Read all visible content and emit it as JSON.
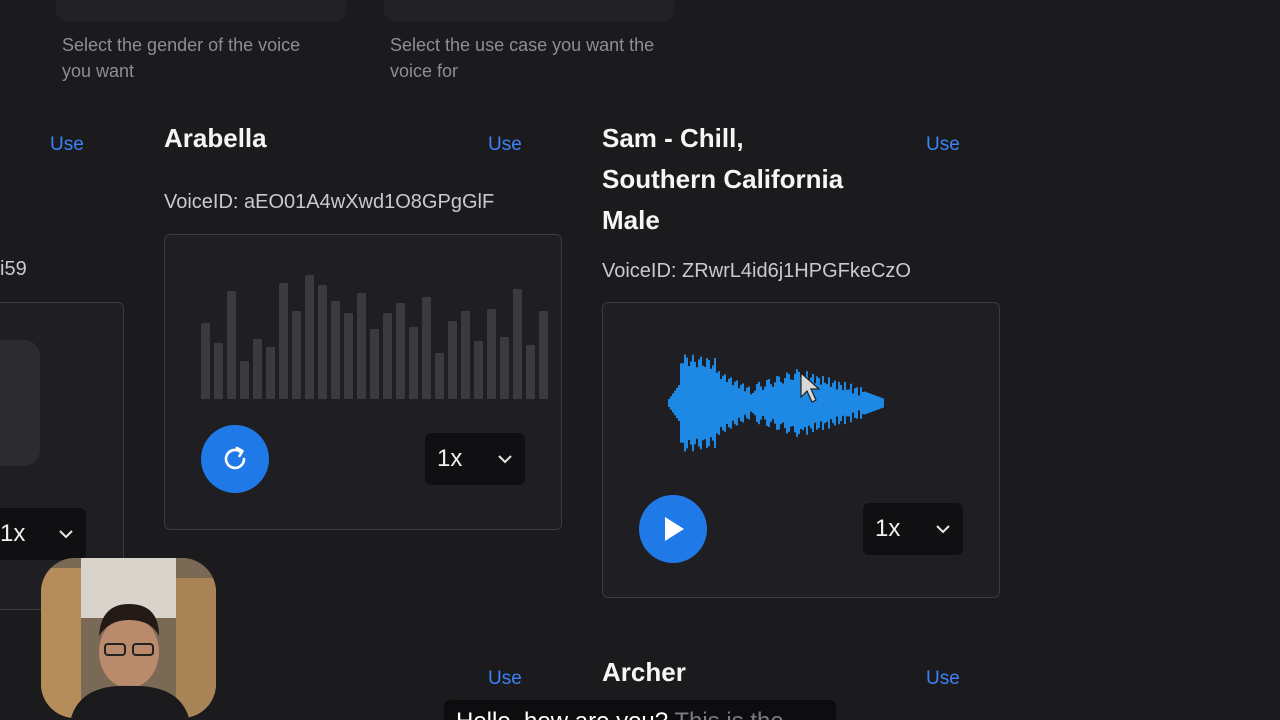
{
  "filters": {
    "gender_help": "Select the gender of the voice you want",
    "use_case_help": "Select the use case you want the voice for"
  },
  "use_label": "Use",
  "left_partial": {
    "voice_id_fragment": "i59",
    "speed": "1x"
  },
  "voices": [
    {
      "name": "Arabella",
      "voice_id": "VoiceID: aEO01A4wXwd1O8GPgGlF",
      "speed": "1x",
      "state": "replay",
      "button_icon": "replay-icon"
    },
    {
      "name_lines": [
        "Sam - Chill,",
        "Southern California",
        "Male"
      ],
      "voice_id": "VoiceID: ZRwrL4id6j1HPGFkeCzO",
      "speed": "1x",
      "state": "paused",
      "button_icon": "play-icon"
    },
    {
      "name": "Archer"
    }
  ],
  "caption": {
    "spoken": "Hello, how are you?",
    "pending": " This is the"
  },
  "colors": {
    "accent": "#1f7ae8",
    "link": "#3b82f6",
    "waveform_active": "#1e88e5",
    "waveform_idle": "#3a3a3f",
    "background": "#1b1b1e"
  }
}
